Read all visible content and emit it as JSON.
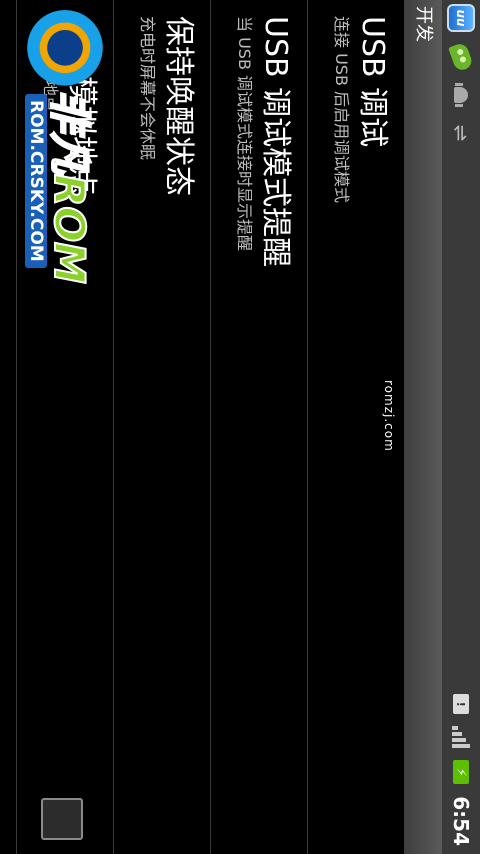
{
  "status_bar": {
    "left_icons": [
      "uu-app-icon",
      "pea-icon",
      "android-debug-icon",
      "usb-icon"
    ],
    "right_icons": [
      "chat-icon",
      "signal-icon",
      "battery-charging-icon"
    ],
    "time": "6:54"
  },
  "title_bar": {
    "title": "开发"
  },
  "watermark_small": "romzj.com",
  "settings": [
    {
      "title": "USB 调试",
      "subtitle": "连接 USB 后启用调试模式"
    },
    {
      "title": "USB 调试模式提醒",
      "subtitle": "当 USB 调试模式连接时显示提醒"
    },
    {
      "title": "保持唤醒状态",
      "subtitle": "充电时屏幕不会休眠"
    },
    {
      "title": "允许模拟地点",
      "subtitle": "允许模拟地点"
    }
  ],
  "logo": {
    "text_main": "非凡",
    "text_rom": "ROM",
    "text_url": "ROM.CRSKY.COM"
  },
  "colors": {
    "accent_green": "#5cc000",
    "title_bar": "#4a4a4a",
    "logo_blue": "#1f6fd6"
  }
}
